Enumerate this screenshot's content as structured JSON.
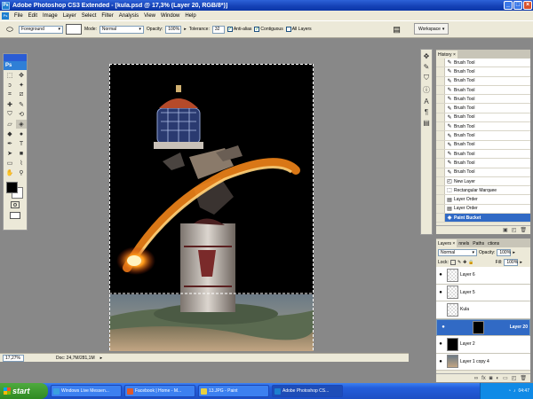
{
  "window": {
    "app_icon": "Ps",
    "title": "Adobe Photoshop CS3 Extended - [kula.psd @ 17,3% (Layer 20, RGB/8*)]"
  },
  "menu": [
    "File",
    "Edit",
    "Image",
    "Layer",
    "Select",
    "Filter",
    "Analysis",
    "View",
    "Window",
    "Help"
  ],
  "options": {
    "fill_source": "Foreground",
    "mode_label": "Mode:",
    "mode_value": "Normal",
    "opacity_label": "Opacity:",
    "opacity_value": "100%",
    "tolerance_label": "Tolerance:",
    "tolerance_value": "32",
    "anti_alias": "Anti-alias",
    "contiguous": "Contiguous",
    "all_layers": "All Layers",
    "workspace": "Workspace"
  },
  "toolbox": {
    "logo": "Ps"
  },
  "status": {
    "zoom": "17,27%",
    "doc": "Doc: 24,7M/281,1M"
  },
  "history": {
    "tab": "History",
    "items": [
      {
        "label": "Brush Tool",
        "icon": "brush-icon"
      },
      {
        "label": "Brush Tool",
        "icon": "brush-icon"
      },
      {
        "label": "Brush Tool",
        "icon": "brush-icon"
      },
      {
        "label": "Brush Tool",
        "icon": "brush-icon"
      },
      {
        "label": "Brush Tool",
        "icon": "brush-icon"
      },
      {
        "label": "Brush Tool",
        "icon": "brush-icon"
      },
      {
        "label": "Brush Tool",
        "icon": "brush-icon"
      },
      {
        "label": "Brush Tool",
        "icon": "brush-icon"
      },
      {
        "label": "Brush Tool",
        "icon": "brush-icon"
      },
      {
        "label": "Brush Tool",
        "icon": "brush-icon"
      },
      {
        "label": "Brush Tool",
        "icon": "brush-icon"
      },
      {
        "label": "Brush Tool",
        "icon": "brush-icon"
      },
      {
        "label": "Brush Tool",
        "icon": "brush-icon"
      },
      {
        "label": "New Layer",
        "icon": "new-layer-icon"
      },
      {
        "label": "Rectangular Marquee",
        "icon": "marquee-icon"
      },
      {
        "label": "Layer Order",
        "icon": "layer-order-icon"
      },
      {
        "label": "Layer Order",
        "icon": "layer-order-icon"
      },
      {
        "label": "Paint Bucket",
        "icon": "paint-bucket-icon"
      }
    ]
  },
  "layers": {
    "tabs": [
      "Layers",
      "nnels",
      "Paths",
      "ctions"
    ],
    "blend": "Normal",
    "opacity_label": "Opacity:",
    "opacity_value": "100%",
    "lock_label": "Lock:",
    "fill_label": "Fill:",
    "fill_value": "100%",
    "items": [
      {
        "name": "Layer 6",
        "visible": true
      },
      {
        "name": "Layer 5",
        "visible": true
      },
      {
        "name": "Kula",
        "visible": false
      },
      {
        "name": "Layer 20",
        "visible": true
      },
      {
        "name": "Layer 2",
        "visible": true
      },
      {
        "name": "Layer 1 copy 4",
        "visible": true
      }
    ]
  },
  "taskbar": {
    "start": "start",
    "tasks": [
      {
        "label": "Windows Live Messen...",
        "color": "#3aa0e0"
      },
      {
        "label": "Facebook | Home - M...",
        "color": "#e05a2a"
      },
      {
        "label": "13.JPG - Paint",
        "color": "#e8d040"
      },
      {
        "label": "Adobe Photoshop CS...",
        "color": "#1d7fd0"
      }
    ],
    "clock": "04:47"
  }
}
